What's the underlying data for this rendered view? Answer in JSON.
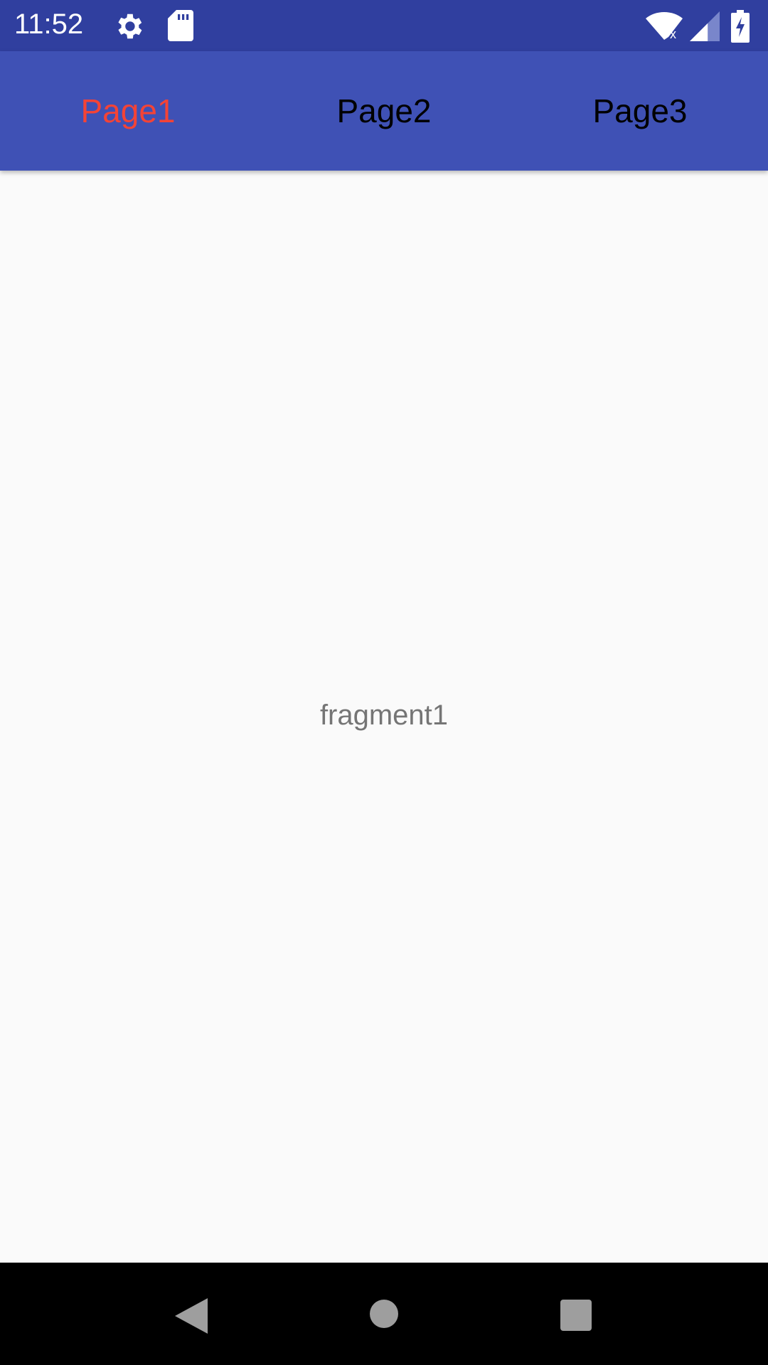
{
  "status_bar": {
    "time": "11:52",
    "icons": [
      "settings-icon",
      "sd-card-icon",
      "wifi-off-icon",
      "signal-icon",
      "battery-charging-icon"
    ]
  },
  "tabs": [
    {
      "label": "Page1",
      "active": true
    },
    {
      "label": "Page2",
      "active": false
    },
    {
      "label": "Page3",
      "active": false
    }
  ],
  "content": {
    "text": "fragment1"
  },
  "colors": {
    "status_bar": "#303f9f",
    "tab_bar": "#3f51b5",
    "active_tab": "#f44336",
    "inactive_tab": "#000000"
  },
  "nav_bar": {
    "buttons": [
      "back",
      "home",
      "recents"
    ]
  }
}
